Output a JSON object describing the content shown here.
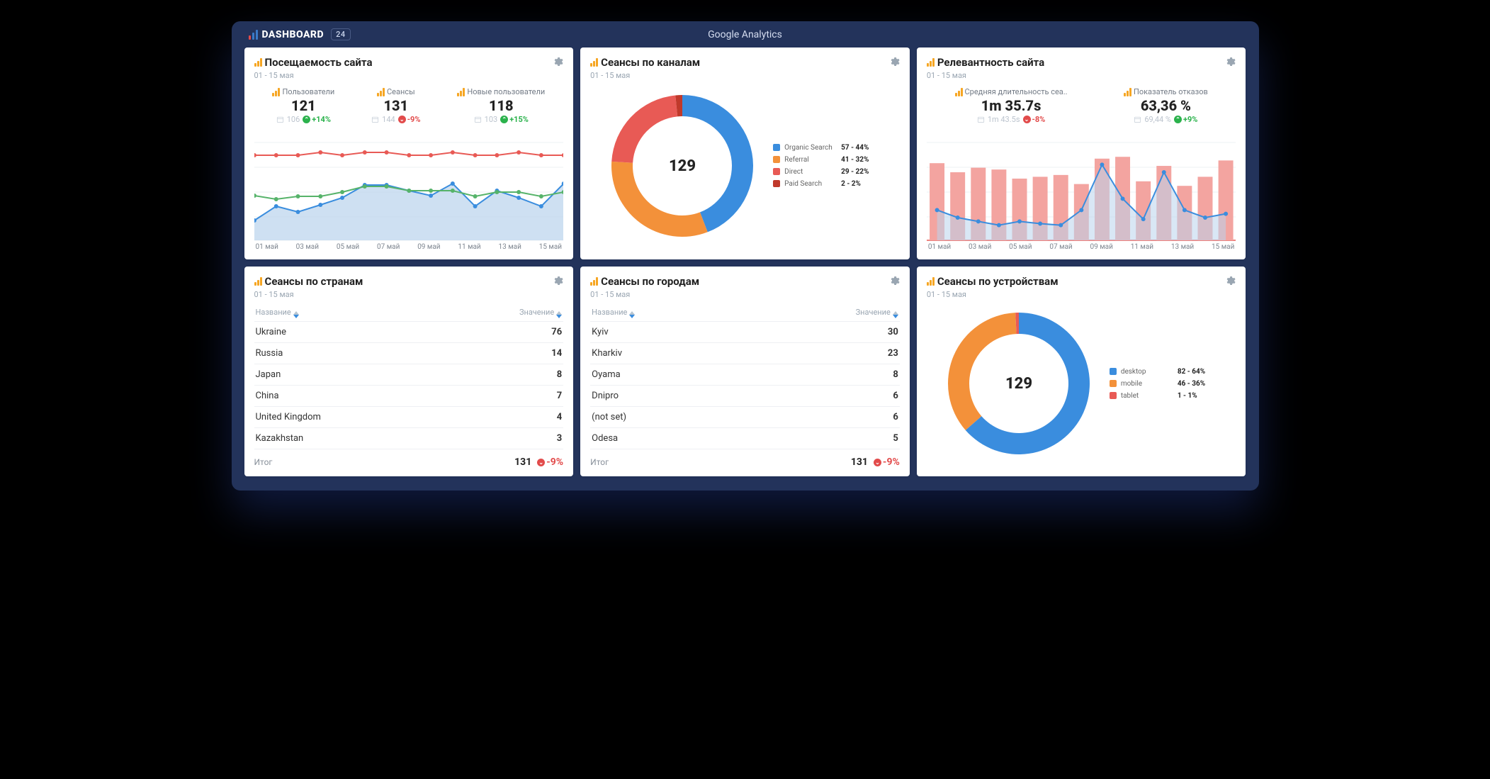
{
  "header": {
    "brand": "DASHBOARD",
    "badge": "24",
    "page_title": "Google Analytics"
  },
  "date_range": "01 - 15 мая",
  "colors": {
    "blue": "#3a8dde",
    "orange": "#f3913a",
    "red": "#e85a55",
    "green": "#56b36a"
  },
  "cards": {
    "traffic": {
      "title": "Посещаемость сайта",
      "metrics": [
        {
          "label": "Пользователи",
          "value": "121",
          "compare": "106",
          "delta": "+14%",
          "dir": "up"
        },
        {
          "label": "Сеансы",
          "value": "131",
          "compare": "144",
          "delta": "-9%",
          "dir": "down"
        },
        {
          "label": "Новые пользователи",
          "value": "118",
          "compare": "103",
          "delta": "+15%",
          "dir": "up"
        }
      ],
      "xlabels": [
        "01 май",
        "03 май",
        "05 май",
        "07 май",
        "09 май",
        "11 май",
        "13 май",
        "15 май"
      ]
    },
    "channels": {
      "title": "Сеансы по каналам",
      "center": "129",
      "items": [
        {
          "name": "Organic Search",
          "value": "57",
          "pct": "44%",
          "color": "#3a8dde"
        },
        {
          "name": "Referral",
          "value": "41",
          "pct": "32%",
          "color": "#f3913a"
        },
        {
          "name": "Direct",
          "value": "29",
          "pct": "22%",
          "color": "#e85a55"
        },
        {
          "name": "Paid Search",
          "value": "2",
          "pct": "2%",
          "color": "#c0392b"
        }
      ]
    },
    "relevance": {
      "title": "Релевантность сайта",
      "metrics": [
        {
          "label": "Средняя длительность сеа..",
          "value": "1m 35.7s",
          "compare": "1m 43.5s",
          "delta": "-8%",
          "dir": "down"
        },
        {
          "label": "Показатель отказов",
          "value": "63,36 %",
          "compare": "69,44 %",
          "delta": "+9%",
          "dir": "up"
        }
      ],
      "xlabels": [
        "01 май",
        "03 май",
        "05 май",
        "07 май",
        "09 май",
        "11 май",
        "13 май",
        "15 май"
      ]
    },
    "countries": {
      "title": "Сеансы по странам",
      "col_name": "Название",
      "col_value": "Значение",
      "rows": [
        {
          "name": "Ukraine",
          "value": "76"
        },
        {
          "name": "Russia",
          "value": "14"
        },
        {
          "name": "Japan",
          "value": "8"
        },
        {
          "name": "China",
          "value": "7"
        },
        {
          "name": "United Kingdom",
          "value": "4"
        },
        {
          "name": "Kazakhstan",
          "value": "3"
        }
      ],
      "total_label": "Итог",
      "total_value": "131",
      "total_delta": "-9%"
    },
    "cities": {
      "title": "Сеансы по городам",
      "col_name": "Название",
      "col_value": "Значение",
      "rows": [
        {
          "name": "Kyiv",
          "value": "30"
        },
        {
          "name": "Kharkiv",
          "value": "23"
        },
        {
          "name": "Oyama",
          "value": "8"
        },
        {
          "name": "Dnipro",
          "value": "6"
        },
        {
          "name": "(not set)",
          "value": "6"
        },
        {
          "name": "Odesa",
          "value": "5"
        }
      ],
      "total_label": "Итог",
      "total_value": "131",
      "total_delta": "-9%"
    },
    "devices": {
      "title": "Сеансы по устройствам",
      "center": "129",
      "items": [
        {
          "name": "desktop",
          "value": "82",
          "pct": "64%",
          "color": "#3a8dde"
        },
        {
          "name": "mobile",
          "value": "46",
          "pct": "36%",
          "color": "#f3913a"
        },
        {
          "name": "tablet",
          "value": "1",
          "pct": "1%",
          "color": "#e85a55"
        }
      ]
    }
  },
  "chart_data": [
    {
      "type": "line",
      "title": "Посещаемость сайта",
      "x": [
        "01 май",
        "02 май",
        "03 май",
        "04 май",
        "05 май",
        "06 май",
        "07 май",
        "08 май",
        "09 май",
        "10 май",
        "11 май",
        "12 май",
        "13 май",
        "14 май",
        "15 май"
      ],
      "series": [
        {
          "name": "Сеансы (red)",
          "values": [
            12,
            12,
            12,
            13,
            12,
            13,
            13,
            12,
            12,
            13,
            12,
            12,
            13,
            12,
            12
          ]
        },
        {
          "name": "Новые пользователи (green)",
          "values": [
            6,
            5,
            6,
            6,
            7,
            8,
            8,
            7,
            7,
            7,
            6,
            7,
            7,
            6,
            7
          ]
        },
        {
          "name": "Пользователи (blue area)",
          "values": [
            3,
            5,
            4,
            5,
            6,
            8,
            8,
            7,
            6,
            8,
            5,
            7,
            6,
            5,
            8
          ]
        }
      ],
      "ylim": [
        0,
        15
      ]
    },
    {
      "type": "pie",
      "title": "Сеансы по каналам",
      "categories": [
        "Organic Search",
        "Referral",
        "Direct",
        "Paid Search"
      ],
      "values": [
        57,
        41,
        29,
        2
      ],
      "total": 129
    },
    {
      "type": "bar",
      "title": "Релевантность сайта",
      "x": [
        "01 май",
        "02 май",
        "03 май",
        "04 май",
        "05 май",
        "06 май",
        "07 май",
        "08 май",
        "09 май",
        "10 май",
        "11 май",
        "12 май",
        "13 май",
        "14 май",
        "15 май"
      ],
      "series": [
        {
          "name": "Показатель отказов % (bars)",
          "values": [
            85,
            75,
            80,
            78,
            68,
            70,
            72,
            62,
            90,
            92,
            65,
            82,
            60,
            70,
            88
          ]
        },
        {
          "name": "Средняя длительность сеанса s (line)",
          "values": [
            40,
            30,
            25,
            20,
            25,
            22,
            20,
            40,
            100,
            55,
            28,
            90,
            40,
            30,
            35
          ]
        }
      ],
      "ylim_bars": [
        0,
        100
      ],
      "ylim_line": [
        0,
        120
      ]
    },
    {
      "type": "table",
      "title": "Сеансы по странам",
      "columns": [
        "Название",
        "Значение"
      ],
      "rows": [
        [
          "Ukraine",
          76
        ],
        [
          "Russia",
          14
        ],
        [
          "Japan",
          8
        ],
        [
          "China",
          7
        ],
        [
          "United Kingdom",
          4
        ],
        [
          "Kazakhstan",
          3
        ]
      ],
      "total": 131
    },
    {
      "type": "table",
      "title": "Сеансы по городам",
      "columns": [
        "Название",
        "Значение"
      ],
      "rows": [
        [
          "Kyiv",
          30
        ],
        [
          "Kharkiv",
          23
        ],
        [
          "Oyama",
          8
        ],
        [
          "Dnipro",
          6
        ],
        [
          "(not set)",
          6
        ],
        [
          "Odesa",
          5
        ]
      ],
      "total": 131
    },
    {
      "type": "pie",
      "title": "Сеансы по устройствам",
      "categories": [
        "desktop",
        "mobile",
        "tablet"
      ],
      "values": [
        82,
        46,
        1
      ],
      "total": 129
    }
  ]
}
